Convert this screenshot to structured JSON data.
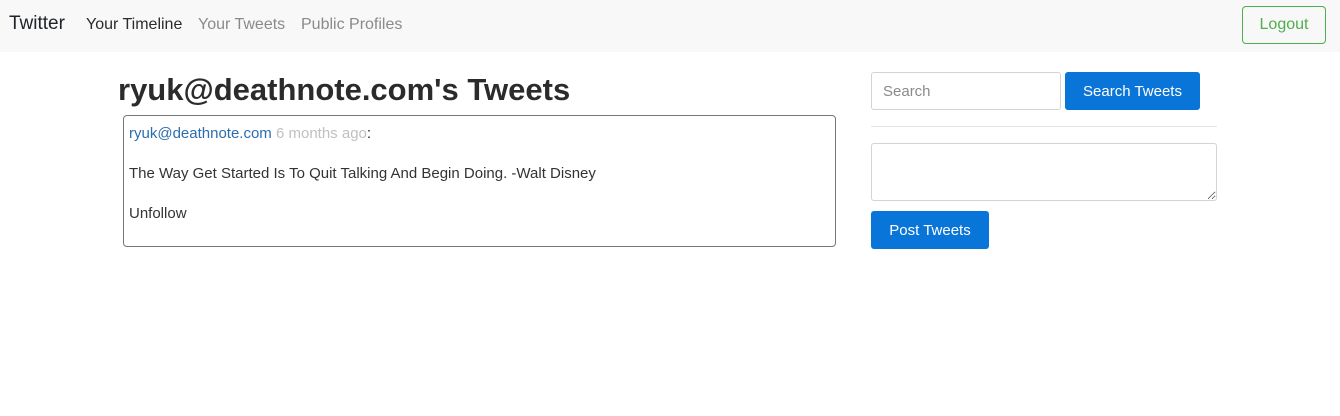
{
  "navbar": {
    "brand": "Twitter",
    "links": [
      {
        "label": "Your Timeline",
        "active": true
      },
      {
        "label": "Your Tweets",
        "active": false
      },
      {
        "label": "Public Profiles",
        "active": false
      }
    ],
    "logout_label": "Logout"
  },
  "main": {
    "title": "ryuk@deathnote.com's Tweets",
    "tweets": [
      {
        "author": "ryuk@deathnote.com",
        "time": "6 months ago",
        "separator": ":",
        "body": "The Way Get Started Is To Quit Talking And Begin Doing. -Walt Disney",
        "action": "Unfollow"
      }
    ]
  },
  "sidebar": {
    "search_placeholder": "Search",
    "search_value": "",
    "search_button": "Search Tweets",
    "compose_value": "",
    "post_button": "Post Tweets"
  },
  "colors": {
    "primary": "#0a75d8",
    "logout": "#4cae4c",
    "link": "#2b6cb0",
    "muted": "#c0c0c0"
  }
}
